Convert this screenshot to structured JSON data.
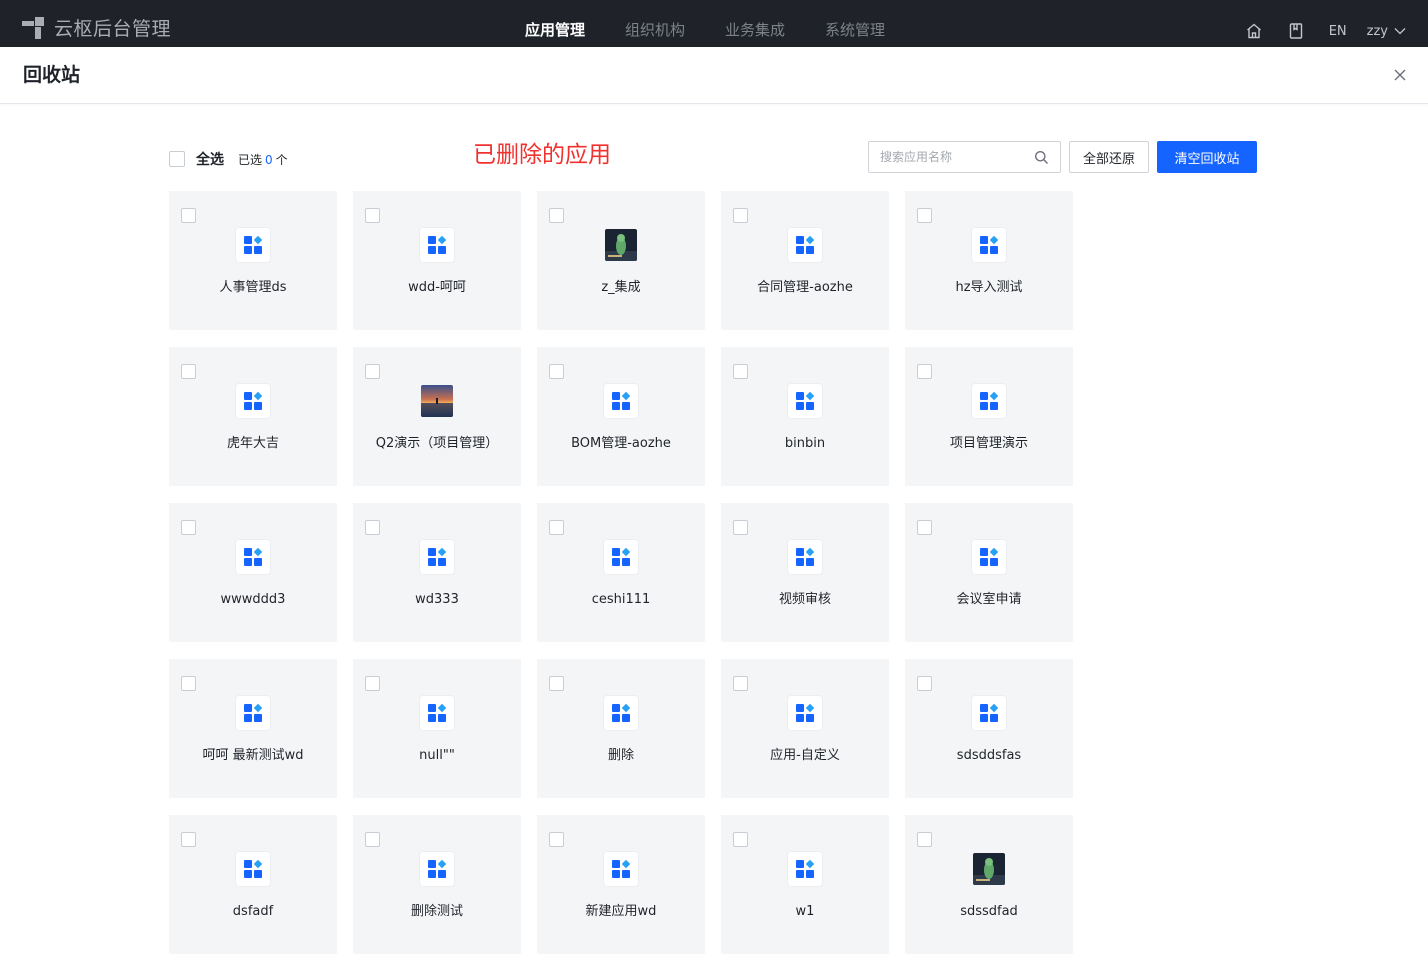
{
  "topbar": {
    "brand": "云枢后台管理",
    "nav": [
      {
        "label": "应用管理",
        "active": true
      },
      {
        "label": "组织机构",
        "active": false
      },
      {
        "label": "业务集成",
        "active": false
      },
      {
        "label": "系统管理",
        "active": false
      }
    ],
    "icons": [
      "home-icon",
      "book-icon"
    ],
    "lang": "EN",
    "user": "zzy"
  },
  "modal": {
    "title": "回收站"
  },
  "toolbar": {
    "select_all": "全选",
    "selected_prefix": "已选",
    "selected_count": "0",
    "selected_suffix": "个",
    "section_title": "已删除的应用",
    "search_placeholder": "搜索应用名称",
    "restore_all": "全部还原",
    "clear_bin": "清空回收站"
  },
  "apps": [
    {
      "name": "人事管理ds",
      "icon": "grid"
    },
    {
      "name": "wdd-呵呵",
      "icon": "grid"
    },
    {
      "name": "z_集成",
      "icon": "image-dark"
    },
    {
      "name": "合同管理-aozhe",
      "icon": "grid"
    },
    {
      "name": "hz导入测试",
      "icon": "grid"
    },
    {
      "name": "虎年大吉",
      "icon": "grid"
    },
    {
      "name": "Q2演示（项目管理）",
      "icon": "image-sunset"
    },
    {
      "name": "BOM管理-aozhe",
      "icon": "grid"
    },
    {
      "name": "binbin",
      "icon": "grid"
    },
    {
      "name": "项目管理演示",
      "icon": "grid"
    },
    {
      "name": "wwwddd3",
      "icon": "grid"
    },
    {
      "name": "wd333",
      "icon": "grid"
    },
    {
      "name": "ceshi111",
      "icon": "grid"
    },
    {
      "name": "视频审核",
      "icon": "grid"
    },
    {
      "name": "会议室申请",
      "icon": "grid"
    },
    {
      "name": "呵呵 最新测试wd",
      "icon": "grid"
    },
    {
      "name": "null\"\"",
      "icon": "grid"
    },
    {
      "name": "删除",
      "icon": "grid"
    },
    {
      "name": "应用-自定义",
      "icon": "grid"
    },
    {
      "name": "sdsddsfas",
      "icon": "grid"
    },
    {
      "name": "dsfadf",
      "icon": "grid"
    },
    {
      "name": "删除测试",
      "icon": "grid"
    },
    {
      "name": "新建应用wd",
      "icon": "grid"
    },
    {
      "name": "w1",
      "icon": "grid"
    },
    {
      "name": "sdssdfad",
      "icon": "image-dark"
    }
  ],
  "colors": {
    "topbar_bg": "#1f2329",
    "primary": "#1664ff",
    "section_title": "#f0322f",
    "card_bg": "#f4f5f7",
    "app_icon_blue": "#1664ff",
    "app_icon_diamond": "#27a0f8"
  }
}
